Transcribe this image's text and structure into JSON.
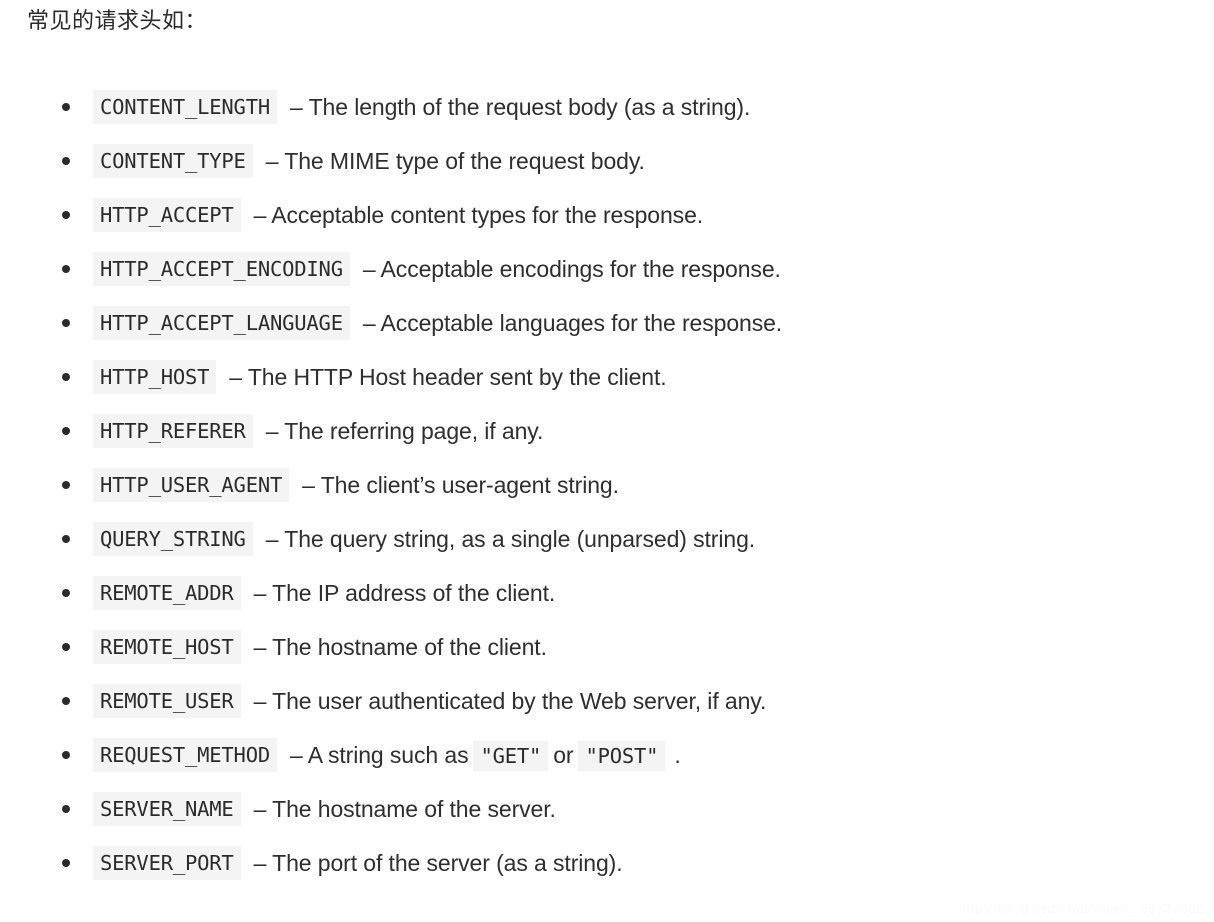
{
  "heading": "常见的请求头如：",
  "list": {
    "items": [
      {
        "code": "CONTENT_LENGTH",
        "desc": "– The length of the request body (as a string)."
      },
      {
        "code": "CONTENT_TYPE",
        "desc": "– The MIME type of the request body."
      },
      {
        "code": "HTTP_ACCEPT",
        "desc": "– Acceptable content types for the response."
      },
      {
        "code": "HTTP_ACCEPT_ENCODING",
        "desc": "– Acceptable encodings for the response."
      },
      {
        "code": "HTTP_ACCEPT_LANGUAGE",
        "desc": "– Acceptable languages for the response."
      },
      {
        "code": "HTTP_HOST",
        "desc": "– The HTTP Host header sent by the client."
      },
      {
        "code": "HTTP_REFERER",
        "desc": "– The referring page, if any."
      },
      {
        "code": "HTTP_USER_AGENT",
        "desc": "– The client’s user-agent string."
      },
      {
        "code": "QUERY_STRING",
        "desc": "– The query string, as a single (unparsed) string."
      },
      {
        "code": "REMOTE_ADDR",
        "desc": "– The IP address of the client."
      },
      {
        "code": "REMOTE_HOST",
        "desc": "– The hostname of the client."
      },
      {
        "code": "REMOTE_USER",
        "desc": "– The user authenticated by the Web server, if any."
      },
      {
        "code": "REQUEST_METHOD",
        "desc_pre": "– A string such as",
        "inline_code_1": "\"GET\"",
        "desc_mid": "or",
        "inline_code_2": "\"POST\"",
        "desc_post": "."
      },
      {
        "code": "SERVER_NAME",
        "desc": "– The hostname of the server."
      },
      {
        "code": "SERVER_PORT",
        "desc": "– The port of the server (as a string)."
      }
    ]
  },
  "watermark": "https://blog.csdn.net/weixin_39737802",
  "colors": {
    "text": "#2f2f2f",
    "code_background": "#f4f4f4",
    "page_background": "#ffffff",
    "watermark": "#fafafa"
  }
}
